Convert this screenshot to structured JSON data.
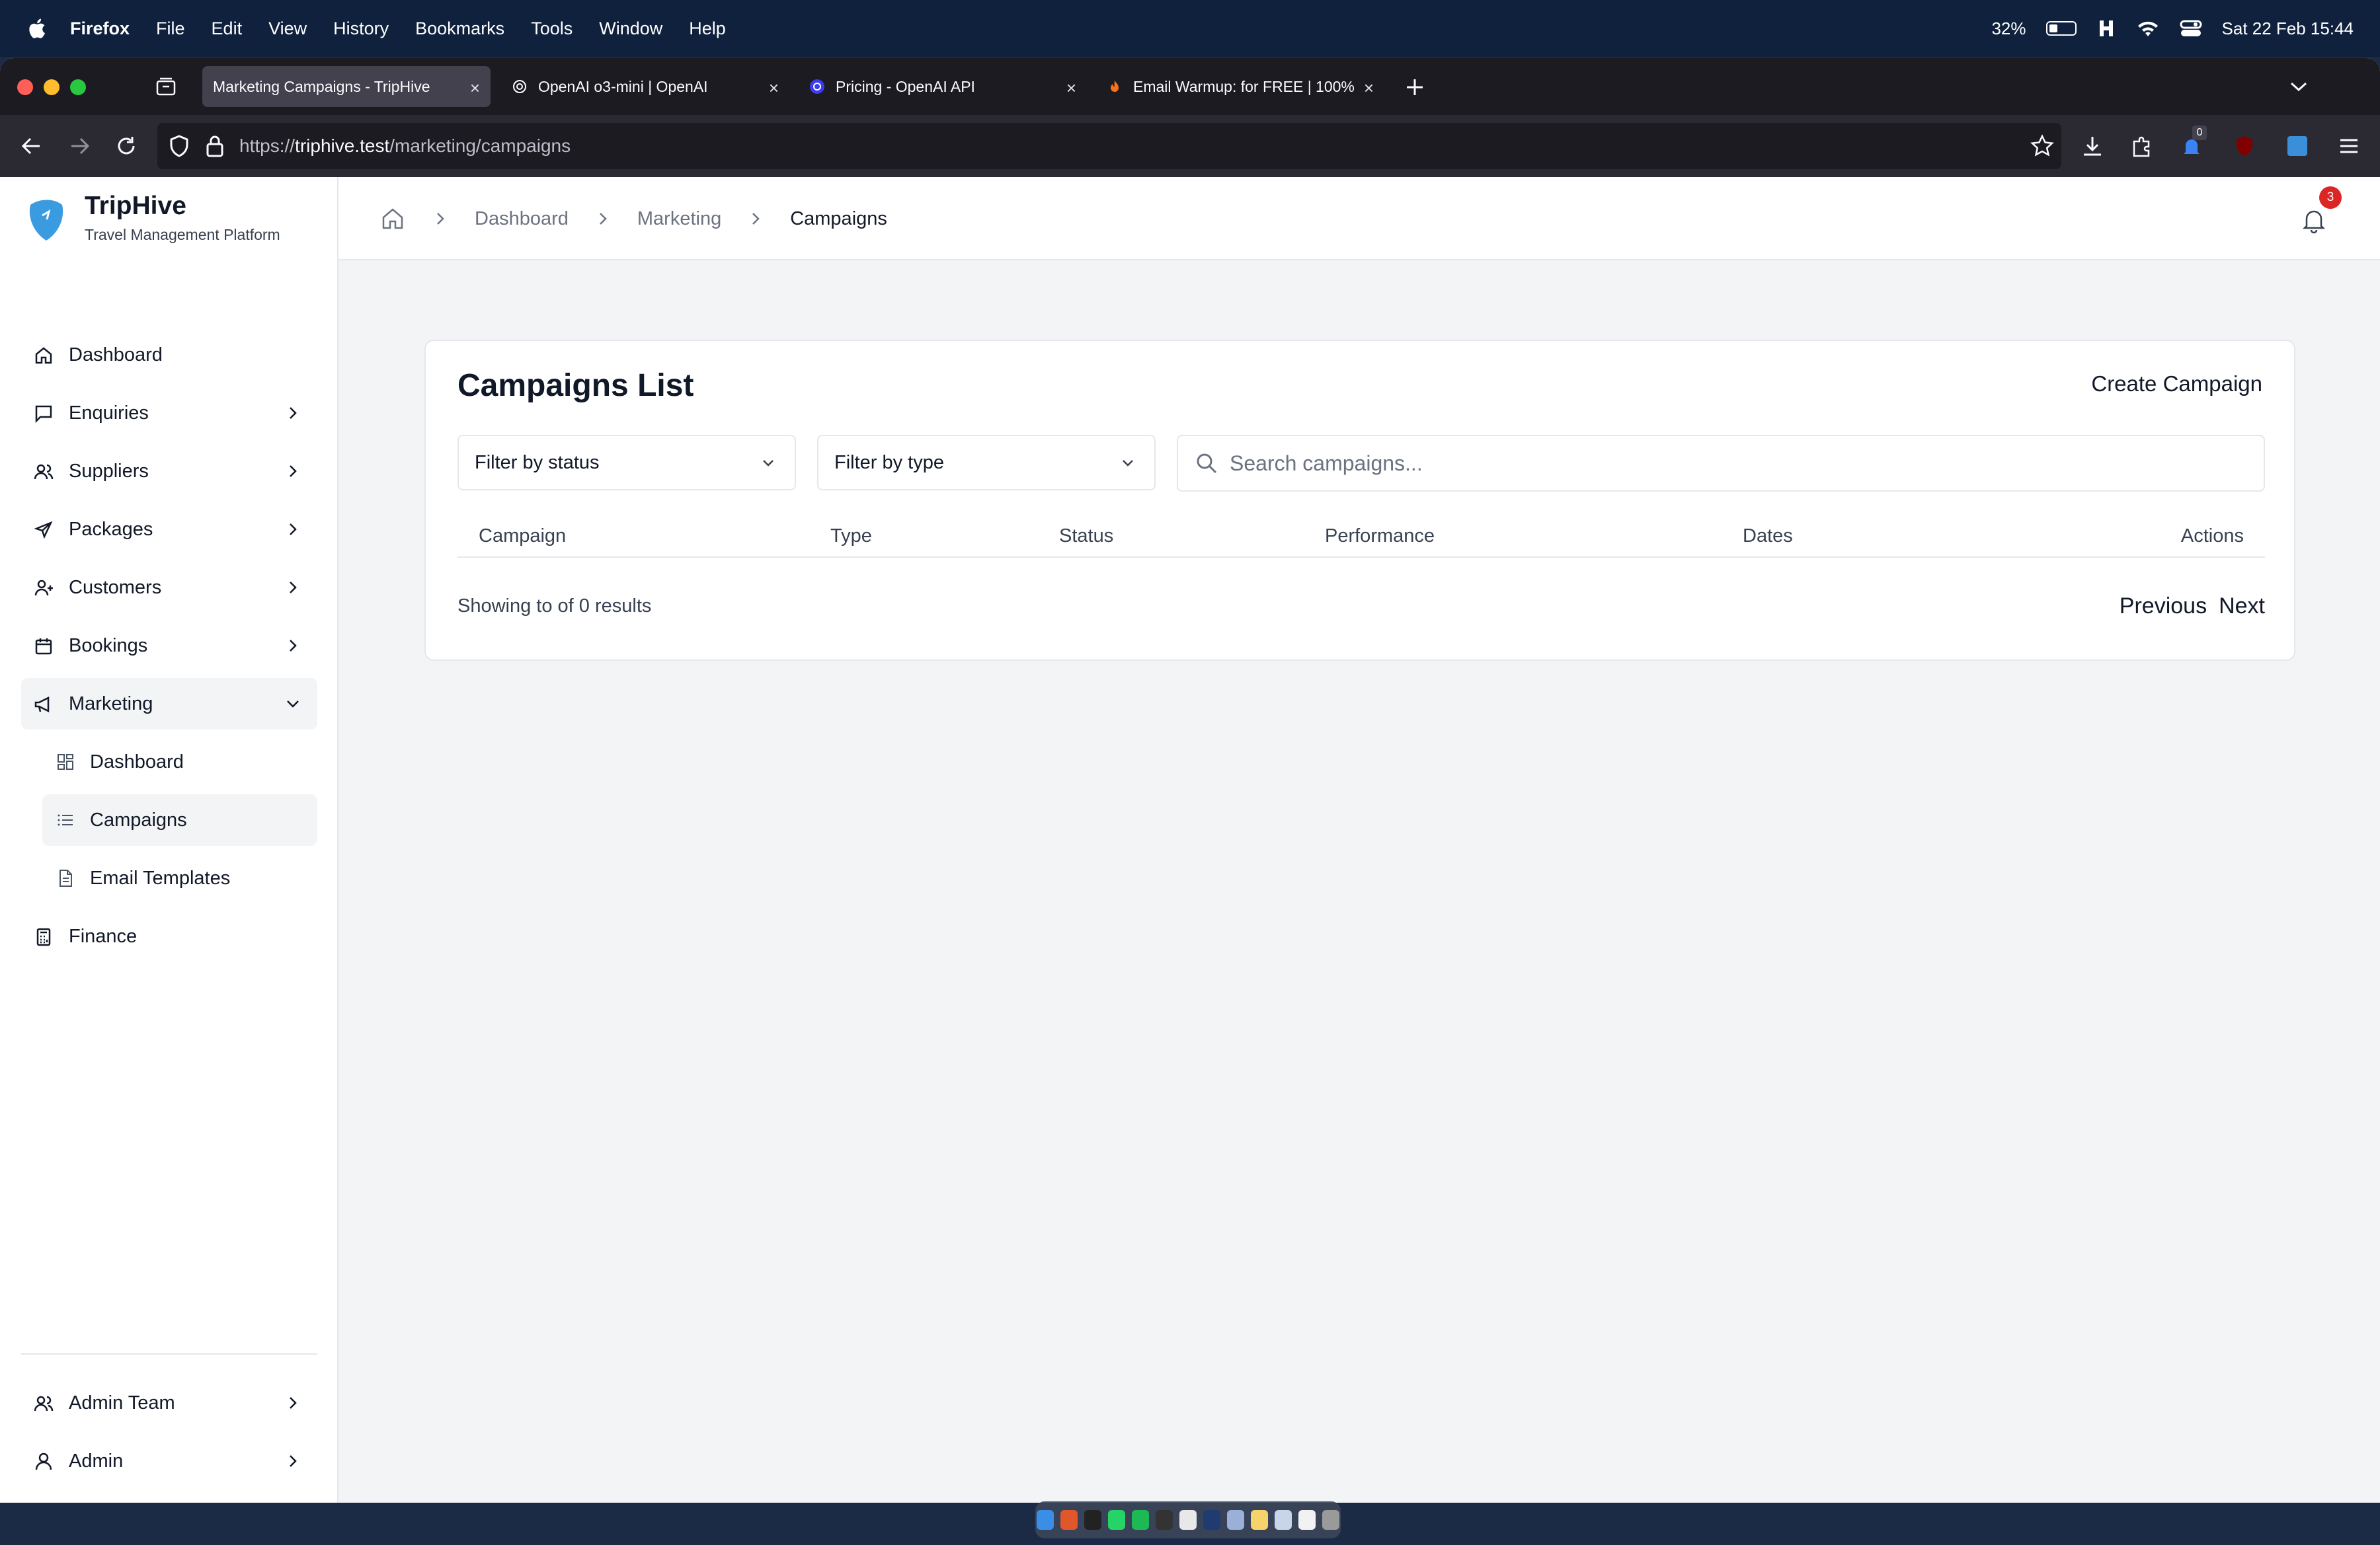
{
  "menubar": {
    "app": "Firefox",
    "items": [
      "File",
      "Edit",
      "View",
      "History",
      "Bookmarks",
      "Tools",
      "Window",
      "Help"
    ],
    "battery": "32%",
    "datetime": "Sat 22 Feb  15:44"
  },
  "browser": {
    "tabs": [
      {
        "title": "Marketing Campaigns - TripHive",
        "active": true
      },
      {
        "title": "OpenAI o3-mini | OpenAI",
        "active": false
      },
      {
        "title": "Pricing - OpenAI API",
        "active": false
      },
      {
        "title": "Email Warmup: for FREE | 100%",
        "active": false
      }
    ],
    "url_prefix": "https://",
    "url_host": "triphive.test",
    "url_path": "/marketing/campaigns",
    "extension_badge": "0"
  },
  "brand": {
    "name": "TripHive",
    "subtitle": "Travel Management Platform",
    "color": "#3b9be0"
  },
  "sidebar": {
    "items": [
      {
        "label": "Dashboard",
        "icon": "home-icon"
      },
      {
        "label": "Enquiries",
        "icon": "message-icon"
      },
      {
        "label": "Suppliers",
        "icon": "users-icon"
      },
      {
        "label": "Packages",
        "icon": "plane-icon"
      },
      {
        "label": "Customers",
        "icon": "user-plus-icon"
      },
      {
        "label": "Bookings",
        "icon": "calendar-icon"
      },
      {
        "label": "Marketing",
        "icon": "megaphone-icon"
      },
      {
        "label": "Finance",
        "icon": "calculator-icon"
      }
    ],
    "marketing_sub": [
      {
        "label": "Dashboard",
        "icon": "grid-icon"
      },
      {
        "label": "Campaigns",
        "icon": "list-icon"
      },
      {
        "label": "Email Templates",
        "icon": "document-icon"
      }
    ],
    "bottom": [
      {
        "label": "Admin Team",
        "icon": "users-icon"
      },
      {
        "label": "Admin",
        "icon": "user-icon"
      }
    ]
  },
  "breadcrumb": {
    "items": [
      "Dashboard",
      "Marketing",
      "Campaigns"
    ]
  },
  "notifications": {
    "count": "3"
  },
  "campaigns": {
    "title": "Campaigns List",
    "create_label": "Create Campaign",
    "filter_status": "Filter by status",
    "filter_type": "Filter by type",
    "search_placeholder": "Search campaigns...",
    "columns": [
      "Campaign",
      "Type",
      "Status",
      "Performance",
      "Dates",
      "Actions"
    ],
    "results_text": "Showing to of 0 results",
    "prev_label": "Previous",
    "next_label": "Next"
  }
}
